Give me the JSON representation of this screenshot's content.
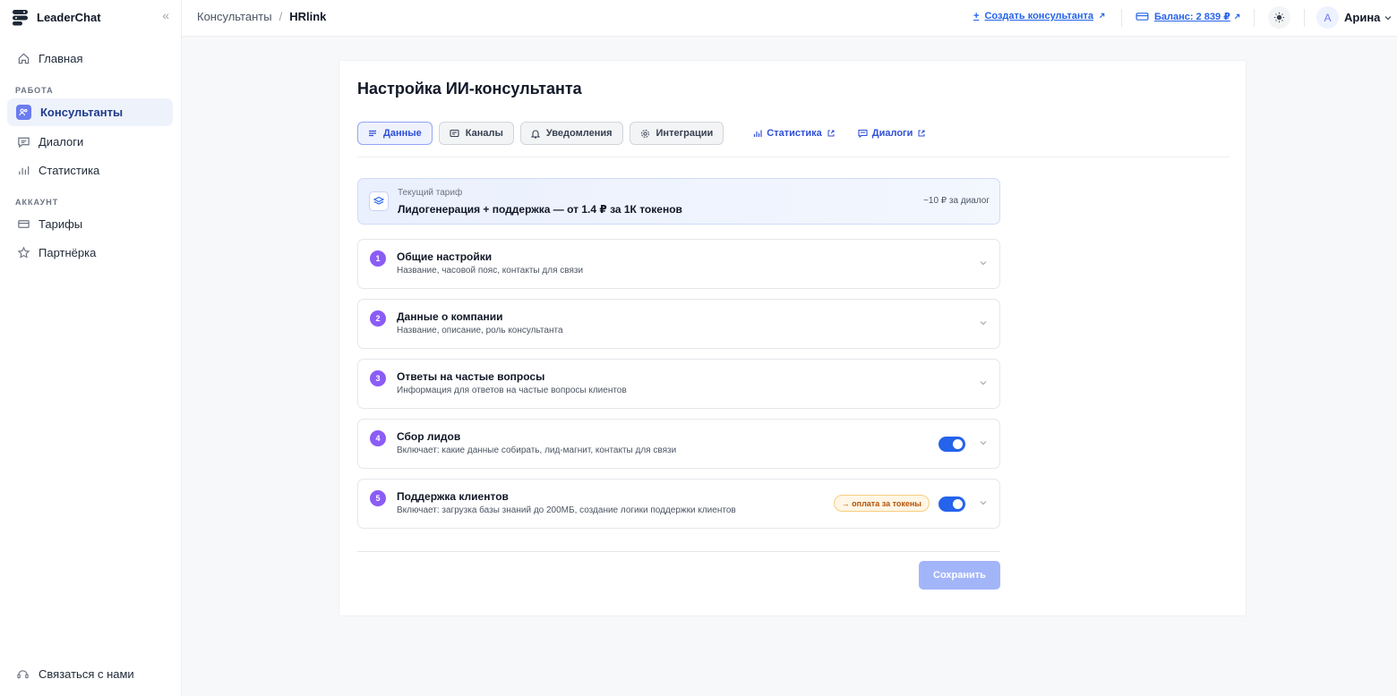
{
  "app": {
    "name": "LeaderChat",
    "collapse_glyph": "«"
  },
  "sidebar": {
    "home": "Главная",
    "section_work": "РАБОТА",
    "consultants": "Консультанты",
    "dialogs": "Диалоги",
    "statistics": "Статистика",
    "section_account": "АККАУНТ",
    "tariffs": "Тарифы",
    "partner": "Партнёрка",
    "contact": "Связаться с нами"
  },
  "topbar": {
    "breadcrumb_parent": "Консультанты",
    "breadcrumb_sep": "/",
    "breadcrumb_current": "HRlink",
    "create_prefix": "+",
    "create_label": "Создать консультанта",
    "balance_label": "Баланс: 2 839 ₽",
    "avatar_letter": "A",
    "user_name": "Арина"
  },
  "page": {
    "title": "Настройка ИИ-консультанта",
    "tabs": [
      "Данные",
      "Каналы",
      "Уведомления",
      "Интеграции"
    ],
    "active_tab": "Данные",
    "links": [
      "Статистика",
      "Диалоги"
    ]
  },
  "tariff": {
    "label": "Текущий тариф",
    "value": "Лидогенерация + поддержка — от 1.4 ₽ за 1К токенов",
    "note": "~10 ₽ за диалог"
  },
  "sections": [
    {
      "num": "1",
      "title": "Общие настройки",
      "subtitle": "Название, часовой пояс, контакты для связи"
    },
    {
      "num": "2",
      "title": "Данные о компании",
      "subtitle": "Название, описание, роль консультанта"
    },
    {
      "num": "3",
      "title": "Ответы на частые вопросы",
      "subtitle": "Информация для ответов на частые вопросы клиентов"
    },
    {
      "num": "4",
      "title": "Сбор лидов",
      "subtitle": "Включает: какие данные собирать, лид-магнит, контакты для связи",
      "toggle_on": true
    },
    {
      "num": "5",
      "title": "Поддержка клиентов",
      "subtitle": "Включает: загрузка базы знаний до 200МБ, создание логики поддержки клиентов",
      "badge": "→ оплата за токены",
      "toggle_on": true
    }
  ],
  "actions": {
    "save": "Сохранить"
  },
  "colors": {
    "accent": "#2563eb",
    "step": "#8b5cf6",
    "save_disabled": "#a3b5f9",
    "badge_bg": "#fff6e5"
  }
}
